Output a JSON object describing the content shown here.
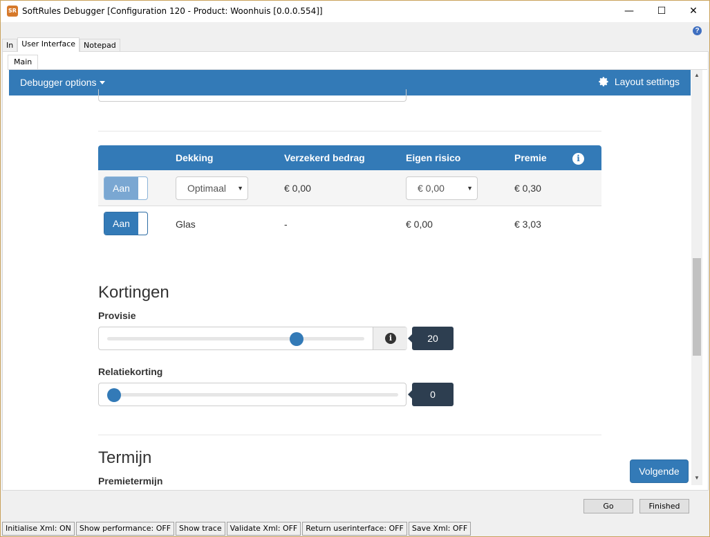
{
  "window": {
    "title": "SoftRules Debugger [Configuration 120 - Product: Woonhuis [0.0.0.554]]",
    "app_icon_text": "SR",
    "minimize": "—",
    "maximize": "☐",
    "close": "✕",
    "help": "?"
  },
  "tabs": [
    {
      "label": "In"
    },
    {
      "label": "User Interface"
    },
    {
      "label": "Notepad"
    }
  ],
  "subtab": {
    "label": "Main"
  },
  "navbar": {
    "debugger_options": "Debugger options",
    "layout_settings": "Layout settings"
  },
  "table": {
    "headers": {
      "dekking": "Dekking",
      "verzekerd": "Verzekerd bedrag",
      "eigen": "Eigen risico",
      "premie": "Premie"
    },
    "info_icon": "i",
    "rows": [
      {
        "toggle": "Aan",
        "dekking": "Optimaal",
        "verzekerd": "€ 0,00",
        "eigen": "€ 0,00",
        "premie": "€ 0,30"
      },
      {
        "toggle": "Aan",
        "dekking": "Glas",
        "verzekerd": "-",
        "eigen": "€ 0,00",
        "premie": "€ 3,03"
      }
    ]
  },
  "kortingen": {
    "title": "Kortingen",
    "provisie_label": "Provisie",
    "provisie_value": "20",
    "provisie_fraction": 0.75,
    "relatie_label": "Relatiekorting",
    "relatie_value": "0",
    "relatie_fraction": 0.0
  },
  "termijn": {
    "title": "Termijn",
    "premietermijn_label": "Premietermijn"
  },
  "next_button": "Volgende",
  "bottom": {
    "go": "Go",
    "finished": "Finished"
  },
  "status": [
    "Initialise Xml: ON",
    "Show performance: OFF",
    "Show trace",
    "Validate Xml: OFF",
    "Return userinterface: OFF",
    "Save Xml: OFF"
  ],
  "colors": {
    "primary": "#337ab7",
    "badge": "#2d3e50"
  }
}
